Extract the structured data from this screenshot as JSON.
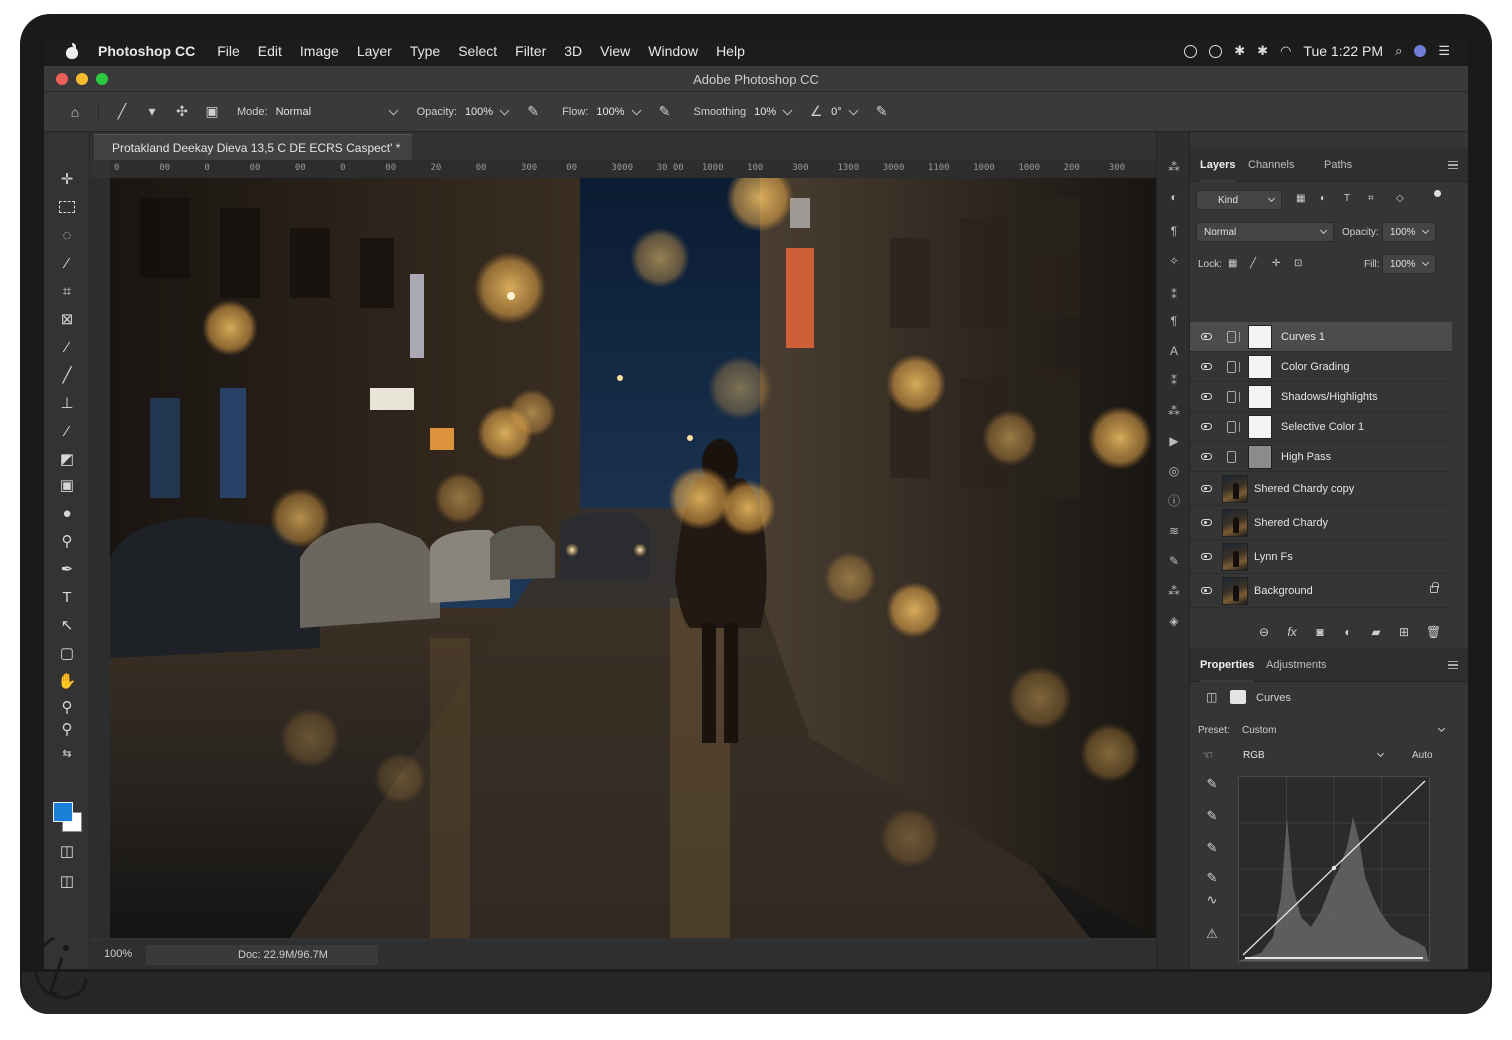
{
  "menubar": {
    "app_name": "Photoshop CC",
    "items": [
      "File",
      "Edit",
      "Image",
      "Layer",
      "Type",
      "Select",
      "Filter",
      "3D",
      "View",
      "Window",
      "Help"
    ],
    "clock": "Tue 1:22 PM"
  },
  "window": {
    "title": "Adobe Photoshop CC"
  },
  "options": {
    "mode_label": "Mode:",
    "mode_value": "Normal",
    "opacity_label": "Opacity:",
    "opacity_value": "100%",
    "flow_label": "Flow:",
    "flow_value": "100%",
    "smoothing_label": "Smoothing",
    "smoothing_value": "10%",
    "angle_value": "0°"
  },
  "document": {
    "tab_title": "Protakland Deekay Dieva 13,5 C DE ECRS Caspect' *",
    "ruler_labels": [
      "0",
      "00",
      "0",
      "00",
      "00",
      "0",
      "00",
      "20",
      "00",
      "300",
      "00",
      "3000",
      "30 00",
      "1000",
      "100",
      "300",
      "1300",
      "3000",
      "1100",
      "1000",
      "1000",
      "200",
      "300"
    ],
    "zoom": "100%",
    "doc_size": "Doc: 22.9M/96.7M"
  },
  "layers_panel": {
    "tabs": [
      "Layers",
      "Channels",
      "Paths"
    ],
    "filter_value": "Kind",
    "blend_mode": "Normal",
    "opacity_label": "Opacity:",
    "opacity_value": "100%",
    "lock_label": "Lock:",
    "fill_label": "Fill:",
    "fill_value": "100%",
    "layers": [
      {
        "name": "Curves 1",
        "kind": "adjustment",
        "selected": true
      },
      {
        "name": "Color Grading",
        "kind": "adjustment"
      },
      {
        "name": "Shadows/Highlights",
        "kind": "adjustment"
      },
      {
        "name": "Selective Color 1",
        "kind": "adjustment"
      },
      {
        "name": "High Pass",
        "kind": "adjustment-gray"
      },
      {
        "name": "Shered Chardy copy",
        "kind": "pixel"
      },
      {
        "name": "Shered Chardy",
        "kind": "pixel"
      },
      {
        "name": "Lynn Fs",
        "kind": "pixel"
      },
      {
        "name": "Background",
        "kind": "pixel",
        "locked": true
      }
    ]
  },
  "properties_panel": {
    "tabs": [
      "Properties",
      "Adjustments"
    ],
    "adjustment_name": "Curves",
    "preset_label": "Preset:",
    "preset_value": "Custom",
    "channel_value": "RGB",
    "auto_label": "Auto"
  },
  "colors": {
    "foreground": "#1a7fd6",
    "background": "#ffffff",
    "ui_dark": "#323232"
  }
}
